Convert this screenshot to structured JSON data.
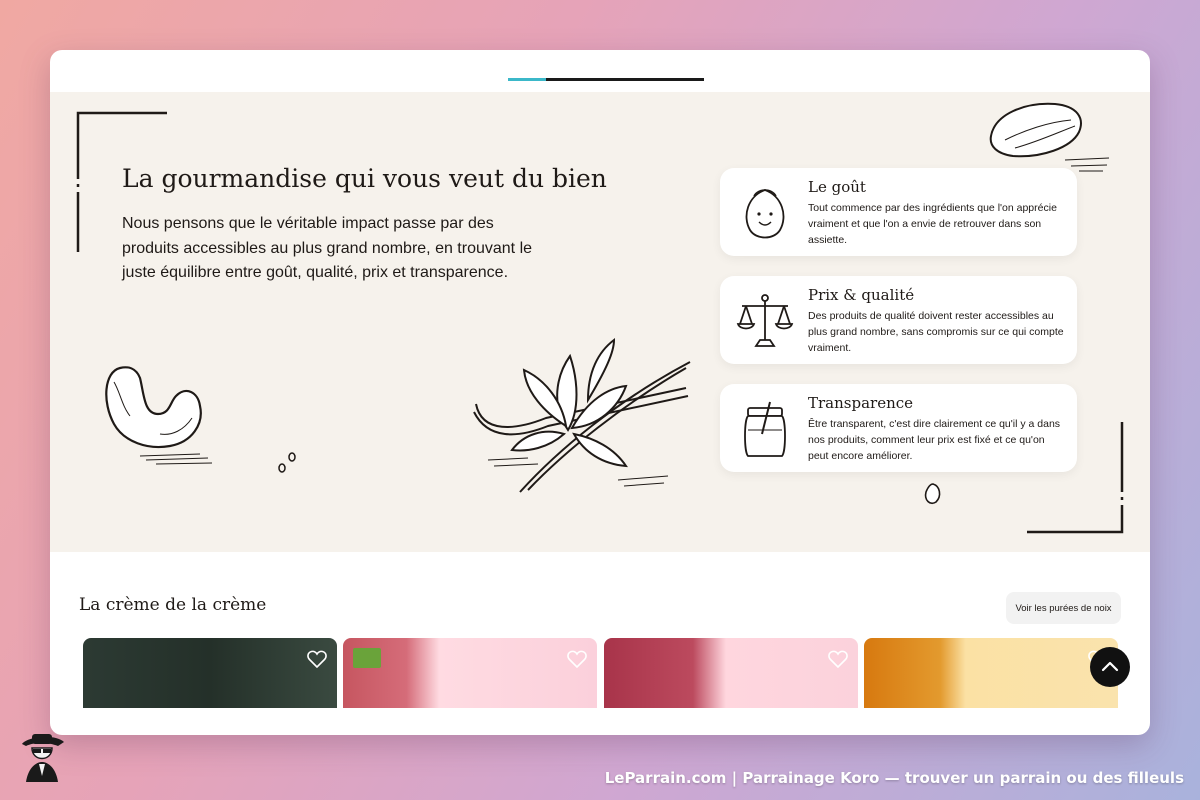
{
  "hero": {
    "title": "La gourmandise qui vous veut du bien",
    "text": "Nous pensons que le véritable impact passe par des produits accessibles au plus grand nombre, en trouvant le juste équilibre entre goût, qualité, prix et transparence."
  },
  "values": [
    {
      "title": "Le goût",
      "text": "Tout commence par des ingrédients que l'on apprécie vraiment et que l'on a envie de retrouver dans son assiette.",
      "icon": "hazelnut-icon"
    },
    {
      "title": "Prix & qualité",
      "text": "Des produits de qualité doivent rester accessibles au plus grand nombre, sans compromis sur ce qui compte vraiment.",
      "icon": "scale-icon"
    },
    {
      "title": "Transparence",
      "text": "Être transparent, c'est dire clairement ce qu'il y a dans nos produits, comment leur prix est fixé et ce qu'on peut encore améliorer.",
      "icon": "jar-icon"
    }
  ],
  "section": {
    "title": "La crème de la crème",
    "see_all_label": "Voir les purées de noix"
  },
  "products": [
    {
      "color": "#2c3a33",
      "organic": false
    },
    {
      "color": "#c65660",
      "organic": true
    },
    {
      "color": "#a8344a",
      "organic": false
    },
    {
      "color": "#d7790f",
      "organic": false
    }
  ],
  "footer": {
    "caption": "LeParrain.com | Parrainage Koro — trouver un parrain ou des filleuls"
  },
  "colors": {
    "hero_bg": "#f6f2ec",
    "tab_active": "#3bb8c9",
    "ink": "#1f1a17"
  }
}
